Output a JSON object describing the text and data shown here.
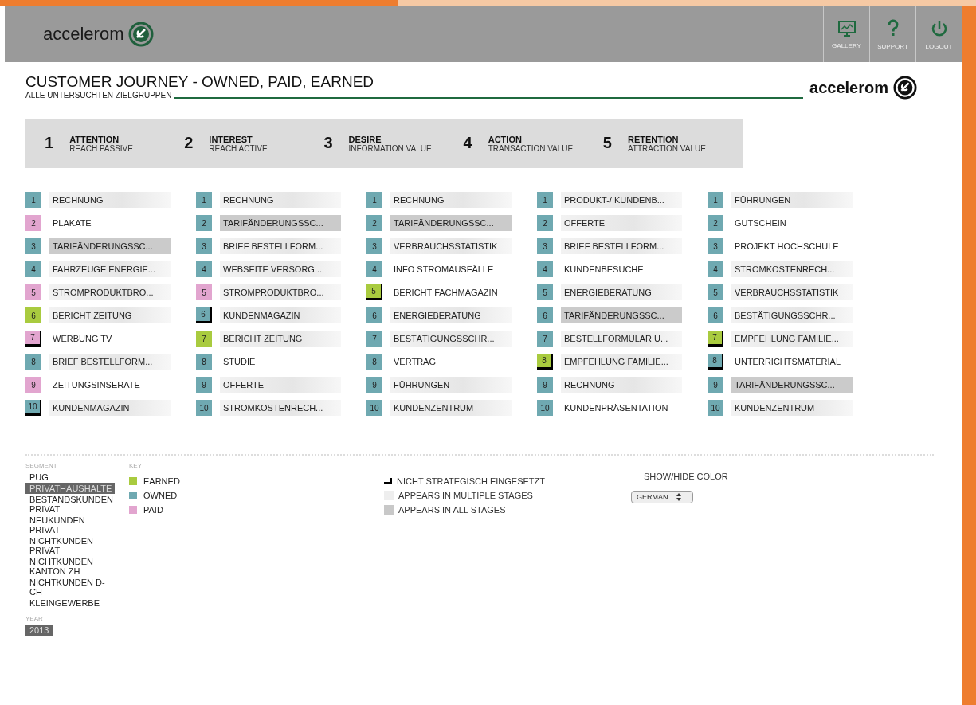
{
  "header": {
    "logo": "accelerom",
    "buttons": [
      {
        "kind": "gallery",
        "label": "GALLERY"
      },
      {
        "kind": "support",
        "label": "SUPPORT"
      },
      {
        "kind": "logout",
        "label": "LOGOUT"
      }
    ]
  },
  "page": {
    "title": "CUSTOMER JOURNEY - OWNED, PAID, EARNED",
    "subtitle": "ALLE UNTERSUCHTEN ZIELGRUPPEN",
    "logo": "accelerom"
  },
  "stages": [
    {
      "number": "1",
      "title": "ATTENTION",
      "subtitle": "REACH PASSIVE"
    },
    {
      "number": "2",
      "title": "INTEREST",
      "subtitle": "REACH ACTIVE"
    },
    {
      "number": "3",
      "title": "DESIRE",
      "subtitle": "INFORMATION VALUE"
    },
    {
      "number": "4",
      "title": "ACTION",
      "subtitle": "TRANSACTION VALUE"
    },
    {
      "number": "5",
      "title": "RETENTION",
      "subtitle": "ATTRACTION VALUE"
    }
  ],
  "columns": [
    {
      "items": [
        {
          "rank": "1",
          "label": "RECHNUNG",
          "kind": "owned",
          "multi_stage": true,
          "all_stages": false,
          "not_strategic": false
        },
        {
          "rank": "2",
          "label": "PLAKATE",
          "kind": "paid",
          "multi_stage": false,
          "all_stages": false,
          "not_strategic": false
        },
        {
          "rank": "3",
          "label": "TARIFÄNDERUNGSSC...",
          "kind": "owned",
          "multi_stage": false,
          "all_stages": true,
          "not_strategic": false
        },
        {
          "rank": "4",
          "label": "FAHRZEUGE ENERGIE...",
          "kind": "owned",
          "multi_stage": true,
          "all_stages": false,
          "not_strategic": false
        },
        {
          "rank": "5",
          "label": "STROMPRODUKTBRO...",
          "kind": "paid",
          "multi_stage": true,
          "all_stages": false,
          "not_strategic": false
        },
        {
          "rank": "6",
          "label": "BERICHT ZEITUNG",
          "kind": "earned",
          "multi_stage": true,
          "all_stages": false,
          "not_strategic": false
        },
        {
          "rank": "7",
          "label": "WERBUNG TV",
          "kind": "paid",
          "multi_stage": false,
          "all_stages": false,
          "not_strategic": true
        },
        {
          "rank": "8",
          "label": "BRIEF BESTELLFORM...",
          "kind": "owned",
          "multi_stage": true,
          "all_stages": false,
          "not_strategic": false
        },
        {
          "rank": "9",
          "label": "ZEITUNGSINSERATE",
          "kind": "paid",
          "multi_stage": false,
          "all_stages": false,
          "not_strategic": false
        },
        {
          "rank": "10",
          "label": "KUNDENMAGAZIN",
          "kind": "owned",
          "multi_stage": true,
          "all_stages": false,
          "not_strategic": true
        }
      ]
    },
    {
      "items": [
        {
          "rank": "1",
          "label": "RECHNUNG",
          "kind": "owned",
          "multi_stage": true,
          "all_stages": false,
          "not_strategic": false
        },
        {
          "rank": "2",
          "label": "TARIFÄNDERUNGSSC...",
          "kind": "owned",
          "multi_stage": false,
          "all_stages": true,
          "not_strategic": false
        },
        {
          "rank": "3",
          "label": "BRIEF BESTELLFORM...",
          "kind": "owned",
          "multi_stage": true,
          "all_stages": false,
          "not_strategic": false
        },
        {
          "rank": "4",
          "label": "WEBSEITE VERSORG...",
          "kind": "owned",
          "multi_stage": true,
          "all_stages": false,
          "not_strategic": false
        },
        {
          "rank": "5",
          "label": "STROMPRODUKTBRO...",
          "kind": "paid",
          "multi_stage": true,
          "all_stages": false,
          "not_strategic": false
        },
        {
          "rank": "6",
          "label": "KUNDENMAGAZIN",
          "kind": "owned",
          "multi_stage": true,
          "all_stages": false,
          "not_strategic": true
        },
        {
          "rank": "7",
          "label": "BERICHT ZEITUNG",
          "kind": "earned",
          "multi_stage": true,
          "all_stages": false,
          "not_strategic": false
        },
        {
          "rank": "8",
          "label": "STUDIE",
          "kind": "owned",
          "multi_stage": false,
          "all_stages": false,
          "not_strategic": false
        },
        {
          "rank": "9",
          "label": "OFFERTE",
          "kind": "owned",
          "multi_stage": true,
          "all_stages": false,
          "not_strategic": false
        },
        {
          "rank": "10",
          "label": "STROMKOSTENRECH...",
          "kind": "owned",
          "multi_stage": true,
          "all_stages": false,
          "not_strategic": false
        }
      ]
    },
    {
      "items": [
        {
          "rank": "1",
          "label": "RECHNUNG",
          "kind": "owned",
          "multi_stage": true,
          "all_stages": false,
          "not_strategic": false
        },
        {
          "rank": "2",
          "label": "TARIFÄNDERUNGSSC...",
          "kind": "owned",
          "multi_stage": false,
          "all_stages": true,
          "not_strategic": false
        },
        {
          "rank": "3",
          "label": "VERBRAUCHSSTATISTIK",
          "kind": "owned",
          "multi_stage": true,
          "all_stages": false,
          "not_strategic": false
        },
        {
          "rank": "4",
          "label": "INFO STROMAUSFÄLLE",
          "kind": "owned",
          "multi_stage": false,
          "all_stages": false,
          "not_strategic": false
        },
        {
          "rank": "5",
          "label": "BERICHT FACHMAGAZIN",
          "kind": "earned",
          "multi_stage": false,
          "all_stages": false,
          "not_strategic": true
        },
        {
          "rank": "6",
          "label": "ENERGIEBERATUNG",
          "kind": "owned",
          "multi_stage": true,
          "all_stages": false,
          "not_strategic": false
        },
        {
          "rank": "7",
          "label": "BESTÄTIGUNGSSCHR...",
          "kind": "owned",
          "multi_stage": true,
          "all_stages": false,
          "not_strategic": false
        },
        {
          "rank": "8",
          "label": "VERTRAG",
          "kind": "owned",
          "multi_stage": false,
          "all_stages": false,
          "not_strategic": false
        },
        {
          "rank": "9",
          "label": "FÜHRUNGEN",
          "kind": "owned",
          "multi_stage": true,
          "all_stages": false,
          "not_strategic": false
        },
        {
          "rank": "10",
          "label": "KUNDENZENTRUM",
          "kind": "owned",
          "multi_stage": true,
          "all_stages": false,
          "not_strategic": false
        }
      ]
    },
    {
      "items": [
        {
          "rank": "1",
          "label": "PRODUKT-/ KUNDENB...",
          "kind": "owned",
          "multi_stage": true,
          "all_stages": false,
          "not_strategic": false
        },
        {
          "rank": "2",
          "label": "OFFERTE",
          "kind": "owned",
          "multi_stage": true,
          "all_stages": false,
          "not_strategic": false
        },
        {
          "rank": "3",
          "label": "BRIEF BESTELLFORM...",
          "kind": "owned",
          "multi_stage": true,
          "all_stages": false,
          "not_strategic": false
        },
        {
          "rank": "4",
          "label": "KUNDENBESUCHE",
          "kind": "owned",
          "multi_stage": false,
          "all_stages": false,
          "not_strategic": false
        },
        {
          "rank": "5",
          "label": "ENERGIEBERATUNG",
          "kind": "owned",
          "multi_stage": true,
          "all_stages": false,
          "not_strategic": false
        },
        {
          "rank": "6",
          "label": "TARIFÄNDERUNGSSC...",
          "kind": "owned",
          "multi_stage": false,
          "all_stages": true,
          "not_strategic": false
        },
        {
          "rank": "7",
          "label": "BESTELLFORMULAR U...",
          "kind": "owned",
          "multi_stage": true,
          "all_stages": false,
          "not_strategic": false
        },
        {
          "rank": "8",
          "label": "EMPFEHLUNG FAMILIE...",
          "kind": "earned",
          "multi_stage": true,
          "all_stages": false,
          "not_strategic": true
        },
        {
          "rank": "9",
          "label": "RECHNUNG",
          "kind": "owned",
          "multi_stage": true,
          "all_stages": false,
          "not_strategic": false
        },
        {
          "rank": "10",
          "label": "KUNDENPRÄSENTATION",
          "kind": "owned",
          "multi_stage": false,
          "all_stages": false,
          "not_strategic": false
        }
      ]
    },
    {
      "items": [
        {
          "rank": "1",
          "label": "FÜHRUNGEN",
          "kind": "owned",
          "multi_stage": true,
          "all_stages": false,
          "not_strategic": false
        },
        {
          "rank": "2",
          "label": "GUTSCHEIN",
          "kind": "owned",
          "multi_stage": false,
          "all_stages": false,
          "not_strategic": false
        },
        {
          "rank": "3",
          "label": "PROJEKT HOCHSCHULE",
          "kind": "owned",
          "multi_stage": false,
          "all_stages": false,
          "not_strategic": false
        },
        {
          "rank": "4",
          "label": "STROMKOSTENRECH...",
          "kind": "owned",
          "multi_stage": true,
          "all_stages": false,
          "not_strategic": false
        },
        {
          "rank": "5",
          "label": "VERBRAUCHSSTATISTIK",
          "kind": "owned",
          "multi_stage": true,
          "all_stages": false,
          "not_strategic": false
        },
        {
          "rank": "6",
          "label": "BESTÄTIGUNGSSCHR...",
          "kind": "owned",
          "multi_stage": true,
          "all_stages": false,
          "not_strategic": false
        },
        {
          "rank": "7",
          "label": "EMPFEHLUNG FAMILIE...",
          "kind": "earned",
          "multi_stage": true,
          "all_stages": false,
          "not_strategic": true
        },
        {
          "rank": "8",
          "label": "UNTERRICHTSMATERIAL",
          "kind": "owned",
          "multi_stage": false,
          "all_stages": false,
          "not_strategic": true
        },
        {
          "rank": "9",
          "label": "TARIFÄNDERUNGSSC...",
          "kind": "owned",
          "multi_stage": false,
          "all_stages": true,
          "not_strategic": false
        },
        {
          "rank": "10",
          "label": "KUNDENZENTRUM",
          "kind": "owned",
          "multi_stage": true,
          "all_stages": false,
          "not_strategic": false
        }
      ]
    }
  ],
  "segment": {
    "heading": "SEGMENT",
    "items": [
      {
        "label": "PUG",
        "selected": false
      },
      {
        "label": "PRIVATHAUSHALTE",
        "selected": true
      },
      {
        "label": "BESTANDSKUNDEN PRIVAT",
        "selected": false
      },
      {
        "label": "NEUKUNDEN PRIVAT",
        "selected": false
      },
      {
        "label": "NICHTKUNDEN PRIVAT",
        "selected": false
      },
      {
        "label": "NICHTKUNDEN KANTON ZH",
        "selected": false
      },
      {
        "label": "NICHTKUNDEN D-CH",
        "selected": false
      },
      {
        "label": "KLEINGEWERBE",
        "selected": false
      }
    ]
  },
  "year": {
    "heading": "YEAR",
    "items": [
      {
        "label": "2013",
        "selected": true
      }
    ]
  },
  "key": {
    "heading": "KEY",
    "items": [
      {
        "label": "EARNED",
        "kind": "earned"
      },
      {
        "label": "OWNED",
        "kind": "owned"
      },
      {
        "label": "PAID",
        "kind": "paid"
      }
    ]
  },
  "markers": [
    {
      "kind": "not_strategic",
      "label": "NICHT STRATEGISCH EINGESETZT"
    },
    {
      "kind": "multiple",
      "label": "APPEARS IN MULTIPLE STAGES"
    },
    {
      "kind": "all",
      "label": "APPEARS IN ALL STAGES"
    }
  ],
  "color_toggle": {
    "label": "SHOW/HIDE COLOR",
    "language": "GERMAN"
  }
}
